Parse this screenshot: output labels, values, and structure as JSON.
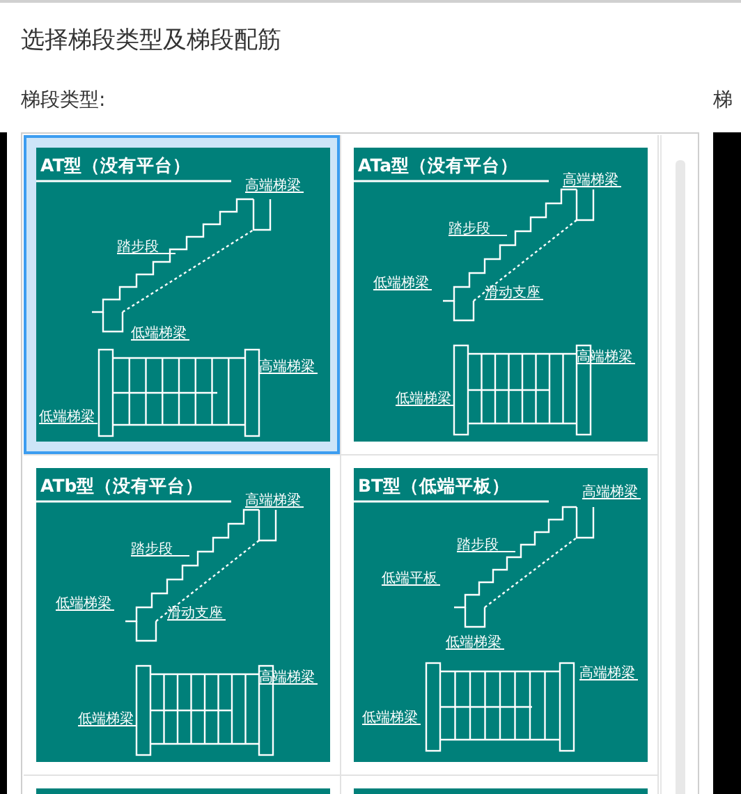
{
  "dialog": {
    "title": "选择梯段类型及梯段配筋"
  },
  "left_label": "梯段类型:",
  "right_label": "梯",
  "tiles": [
    {
      "kind": "at",
      "selected": true,
      "title": "AT型（没有平台）",
      "labels": [
        "高端梯梁",
        "踏步段",
        "低端梯梁",
        "高端梯梁",
        "低端梯梁"
      ]
    },
    {
      "kind": "ata",
      "selected": false,
      "title": "ATa型（没有平台）",
      "labels": [
        "高端梯梁",
        "踏步段",
        "低端梯梁",
        "滑动支座",
        "高端梯梁",
        "低端梯梁"
      ]
    },
    {
      "kind": "ata",
      "selected": false,
      "title": "ATb型（没有平台）",
      "labels": [
        "高端梯梁",
        "踏步段",
        "低端梯梁",
        "滑动支座",
        "高端梯梁",
        "低端梯梁"
      ]
    },
    {
      "kind": "bt",
      "selected": false,
      "title": "BT型（低端平板）",
      "labels": [
        "高端梯梁",
        "踏步段",
        "低端平板",
        "低端梯梁",
        "高端梯梁",
        "低端梯梁"
      ]
    },
    {
      "kind": "cut",
      "selected": false
    },
    {
      "kind": "cut",
      "selected": false
    }
  ]
}
